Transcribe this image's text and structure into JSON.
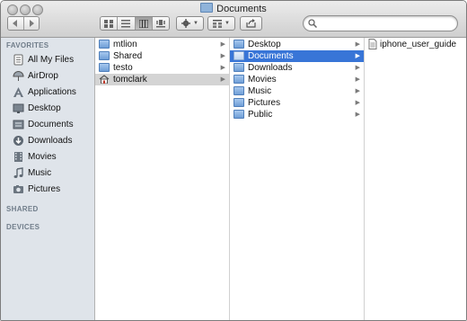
{
  "window": {
    "title": "Documents"
  },
  "toolbar": {
    "back_icon": "back-arrow-icon",
    "forward_icon": "forward-arrow-icon",
    "views": [
      "icon-view-icon",
      "list-view-icon",
      "column-view-icon",
      "coverflow-view-icon"
    ],
    "active_view": "column-view-icon",
    "action_icon": "gear-icon",
    "arrange_icon": "arrange-grid-icon",
    "share_icon": "share-icon",
    "search": {
      "value": "",
      "placeholder": ""
    }
  },
  "sidebar": {
    "favorites_label": "FAVORITES",
    "items": [
      {
        "label": "All My Files",
        "icon": "all-files-icon"
      },
      {
        "label": "AirDrop",
        "icon": "airdrop-icon"
      },
      {
        "label": "Applications",
        "icon": "applications-icon"
      },
      {
        "label": "Desktop",
        "icon": "desktop-icon"
      },
      {
        "label": "Documents",
        "icon": "documents-icon"
      },
      {
        "label": "Downloads",
        "icon": "downloads-icon"
      },
      {
        "label": "Movies",
        "icon": "movies-icon"
      },
      {
        "label": "Music",
        "icon": "music-icon"
      },
      {
        "label": "Pictures",
        "icon": "pictures-icon"
      }
    ],
    "shared_label": "SHARED",
    "devices_label": "DEVICES"
  },
  "columns": [
    {
      "items": [
        {
          "label": "mtlion",
          "icon": "folder-icon",
          "has_children": true
        },
        {
          "label": "Shared",
          "icon": "folder-icon",
          "has_children": true
        },
        {
          "label": "testo",
          "icon": "folder-icon",
          "has_children": true
        },
        {
          "label": "tomclark",
          "icon": "home-icon",
          "has_children": true,
          "selected": "inactive"
        }
      ]
    },
    {
      "items": [
        {
          "label": "Desktop",
          "icon": "folder-icon",
          "has_children": true
        },
        {
          "label": "Documents",
          "icon": "folder-icon",
          "has_children": true,
          "selected": "active"
        },
        {
          "label": "Downloads",
          "icon": "folder-icon",
          "has_children": true
        },
        {
          "label": "Movies",
          "icon": "folder-icon",
          "has_children": true
        },
        {
          "label": "Music",
          "icon": "folder-icon",
          "has_children": true
        },
        {
          "label": "Pictures",
          "icon": "folder-icon",
          "has_children": true
        },
        {
          "label": "Public",
          "icon": "folder-icon",
          "has_children": true
        }
      ]
    },
    {
      "items": [
        {
          "label": "iphone_user_guide",
          "icon": "document-icon",
          "has_children": false
        }
      ]
    }
  ],
  "colors": {
    "selection_active": "#3875d7",
    "selection_inactive": "#d4d4d4",
    "sidebar_bg": "#dfe4ea"
  }
}
